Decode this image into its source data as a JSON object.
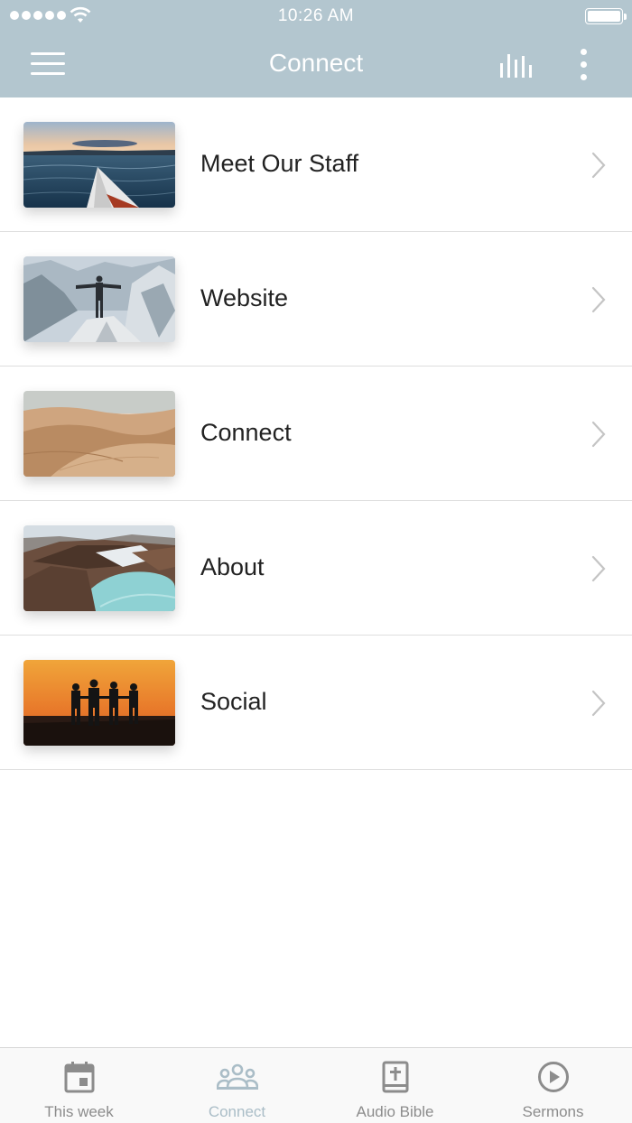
{
  "status_bar": {
    "time": "10:26 AM"
  },
  "nav": {
    "title": "Connect"
  },
  "list": {
    "items": [
      {
        "label": "Meet Our Staff",
        "thumbnail": "lake-kayak-photo"
      },
      {
        "label": "Website",
        "thumbnail": "mountain-peak-person-photo"
      },
      {
        "label": "Connect",
        "thumbnail": "desert-dunes-photo"
      },
      {
        "label": "About",
        "thumbnail": "volcanic-crater-lake-photo"
      },
      {
        "label": "Social",
        "thumbnail": "sunset-silhouettes-photo"
      }
    ]
  },
  "tab_bar": {
    "tabs": [
      {
        "label": "This week",
        "icon": "calendar-icon",
        "active": false
      },
      {
        "label": "Connect",
        "icon": "people-icon",
        "active": true
      },
      {
        "label": "Audio Bible",
        "icon": "bible-icon",
        "active": false
      },
      {
        "label": "Sermons",
        "icon": "play-circle-icon",
        "active": false
      }
    ]
  },
  "colors": {
    "header": "#b3c6cf",
    "active_tab": "#aabdc7",
    "inactive_tab": "#8c8c8c",
    "text": "#222222"
  }
}
